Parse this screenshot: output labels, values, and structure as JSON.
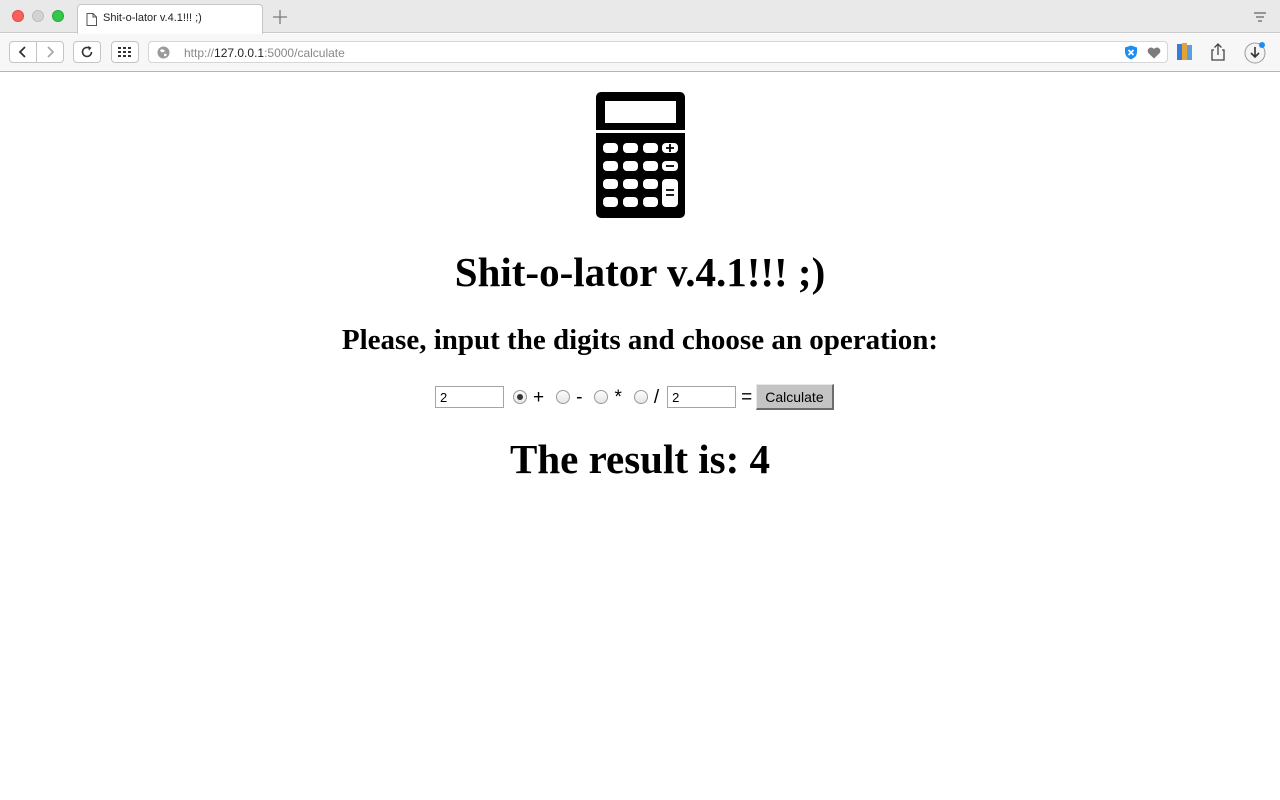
{
  "browser": {
    "tab_title": "Shit-o-lator v.4.1!!! ;)",
    "url_scheme": "http://",
    "url_host": "127.0.0.1",
    "url_rest": ":5000/calculate"
  },
  "page": {
    "logo_icon": "calculator-icon",
    "title": "Shit-o-lator v.4.1!!! ;)",
    "instruction": "Please, input the digits and choose an operation:",
    "form": {
      "first_value": "2",
      "second_value": "2",
      "operations": [
        "+",
        "-",
        "*",
        "/"
      ],
      "selected_operation": "+",
      "equals": "=",
      "button_label": "Calculate"
    },
    "result_label": "The result is: 4"
  },
  "icons": {
    "back": "chevron-left-icon",
    "forward": "chevron-right-icon",
    "reload": "reload-icon",
    "apps": "apps-grid-icon",
    "site": "globe-icon",
    "shield": "shield-icon",
    "heart": "heart-icon",
    "books": "books-icon",
    "share": "share-icon",
    "download": "download-icon"
  }
}
